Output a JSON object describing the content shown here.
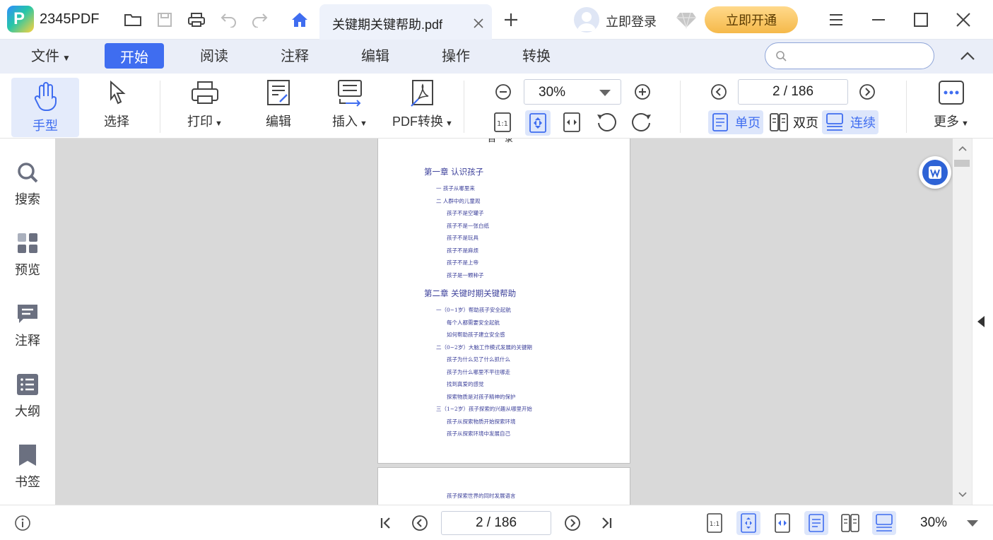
{
  "app": {
    "name": "2345PDF",
    "logo_letter": "P"
  },
  "tab": {
    "title": "关键期关键帮助.pdf"
  },
  "account": {
    "login_label": "立即登录",
    "vip_label": "立即开通"
  },
  "menu": {
    "file": "文件",
    "start": "开始",
    "read": "阅读",
    "annotate": "注释",
    "edit": "编辑",
    "operate": "操作",
    "convert": "转换"
  },
  "search": {
    "placeholder": ""
  },
  "toolbar": {
    "hand": "手型",
    "select": "选择",
    "print": "打印",
    "edit": "编辑",
    "insert": "插入",
    "pdf_convert": "PDF转换",
    "zoom": "30%",
    "page": "2 / 186",
    "single_page": "单页",
    "double_page": "双页",
    "continuous": "连续",
    "more": "更多"
  },
  "sidebar": {
    "search": "搜索",
    "preview": "预览",
    "annotate": "注释",
    "outline": "大纲",
    "bookmark": "书签"
  },
  "document": {
    "page_heading_partial": "目  录",
    "chapter1": {
      "title": "第一章 认识孩子",
      "items": [
        {
          "level": 1,
          "text": "一 孩子从哪里来"
        },
        {
          "level": 1,
          "text": "二 人群中的儿童观"
        },
        {
          "level": 2,
          "text": "孩子不是空罐子"
        },
        {
          "level": 2,
          "text": "孩子不是一张白纸"
        },
        {
          "level": 2,
          "text": "孩子不是玩具"
        },
        {
          "level": 2,
          "text": "孩子不是麻烦"
        },
        {
          "level": 2,
          "text": "孩子不是上帝"
        },
        {
          "level": 2,
          "text": "孩子是一颗种子"
        }
      ]
    },
    "chapter2": {
      "title": "第二章 关键时期关键帮助",
      "items": [
        {
          "level": 1,
          "text": "一（0~1岁）帮助孩子安全起航"
        },
        {
          "level": 2,
          "text": "每个人都需要安全起航"
        },
        {
          "level": 2,
          "text": "如何帮助孩子建立安全感"
        },
        {
          "level": 1,
          "text": "二（0~2岁）大脑工作模式发展的关键期"
        },
        {
          "level": 2,
          "text": "孩子为什么见了什么抓什么"
        },
        {
          "level": 2,
          "text": "孩子为什么哪里不平往哪走"
        },
        {
          "level": 2,
          "text": "找到真爱的感觉"
        },
        {
          "level": 2,
          "text": "探索物质是对孩子精神的保护"
        },
        {
          "level": 1,
          "text": "三（1~2岁）孩子探索的兴趣从哪里开始"
        },
        {
          "level": 2,
          "text": "孩子从探索物质开始探索环境"
        },
        {
          "level": 2,
          "text": "孩子从探索环境中发展自己"
        }
      ]
    },
    "page2_line": "孩子探索世界的同时发展语言"
  },
  "status": {
    "page": "2 / 186",
    "zoom": "30%"
  },
  "colors": {
    "accent": "#3f6df0",
    "toc_text": "#3b3f9a",
    "vip": "#f5b94a"
  }
}
